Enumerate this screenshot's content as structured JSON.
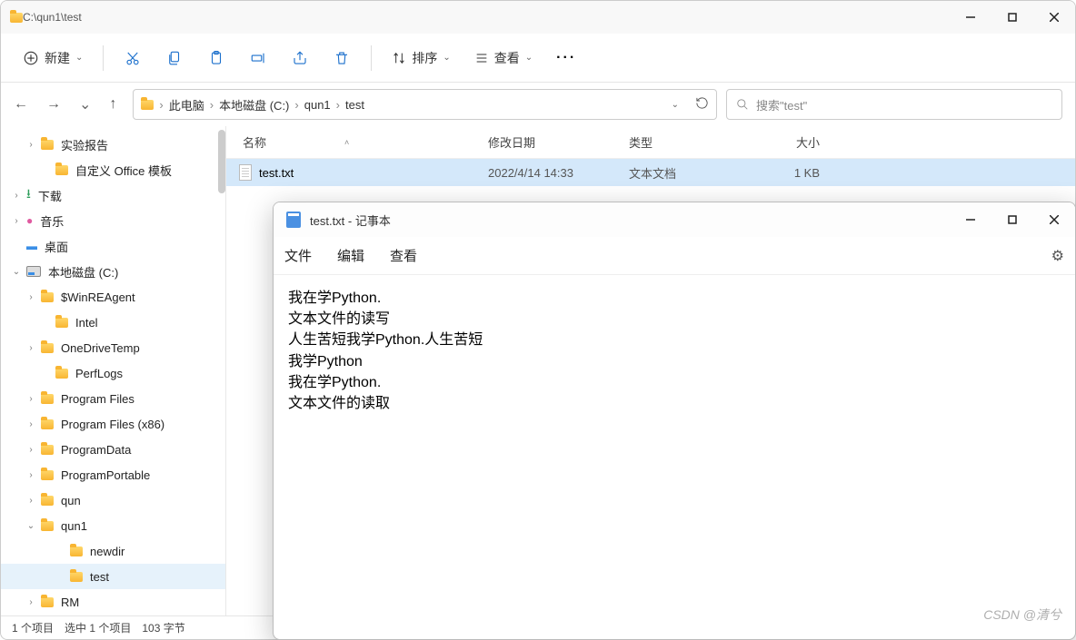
{
  "explorer": {
    "titlePath": "C:\\qun1\\test",
    "toolbar": {
      "new": "新建",
      "sort": "排序",
      "view": "查看"
    },
    "breadcrumb": [
      "此电脑",
      "本地磁盘 (C:)",
      "qun1",
      "test"
    ],
    "searchPlaceholder": "搜索\"test\"",
    "columns": {
      "name": "名称",
      "date": "修改日期",
      "type": "类型",
      "size": "大小"
    },
    "file": {
      "name": "test.txt",
      "date": "2022/4/14 14:33",
      "type": "文本文档",
      "size": "1 KB"
    },
    "tree": [
      {
        "label": "实验报告",
        "indent": 1,
        "arrow": ">",
        "folder": true
      },
      {
        "label": "自定义 Office 模板",
        "indent": 2,
        "arrow": "",
        "folder": true
      },
      {
        "label": "下载",
        "indent": 0,
        "arrow": ">",
        "icon": "download"
      },
      {
        "label": "音乐",
        "indent": 0,
        "arrow": ">",
        "icon": "music"
      },
      {
        "label": "桌面",
        "indent": 0,
        "arrow": "",
        "icon": "desktop"
      },
      {
        "label": "本地磁盘 (C:)",
        "indent": 0,
        "arrow": "v",
        "icon": "disk"
      },
      {
        "label": "$WinREAgent",
        "indent": 1,
        "arrow": ">",
        "folder": true
      },
      {
        "label": "Intel",
        "indent": 2,
        "arrow": "",
        "folder": true
      },
      {
        "label": "OneDriveTemp",
        "indent": 1,
        "arrow": ">",
        "folder": true
      },
      {
        "label": "PerfLogs",
        "indent": 2,
        "arrow": "",
        "folder": true
      },
      {
        "label": "Program Files",
        "indent": 1,
        "arrow": ">",
        "folder": true
      },
      {
        "label": "Program Files (x86)",
        "indent": 1,
        "arrow": ">",
        "folder": true
      },
      {
        "label": "ProgramData",
        "indent": 1,
        "arrow": ">",
        "folder": true
      },
      {
        "label": "ProgramPortable",
        "indent": 1,
        "arrow": ">",
        "folder": true
      },
      {
        "label": "qun",
        "indent": 1,
        "arrow": ">",
        "folder": true
      },
      {
        "label": "qun1",
        "indent": 1,
        "arrow": "v",
        "folder": true
      },
      {
        "label": "newdir",
        "indent": 3,
        "arrow": "",
        "folder": true
      },
      {
        "label": "test",
        "indent": 3,
        "arrow": "",
        "folder": true,
        "selected": true
      },
      {
        "label": "RM",
        "indent": 1,
        "arrow": ">",
        "folder": true
      }
    ],
    "status": {
      "items": "1 个项目",
      "selected": "选中 1 个项目",
      "bytes": "103 字节"
    }
  },
  "notepad": {
    "title": "test.txt - 记事本",
    "menus": {
      "file": "文件",
      "edit": "编辑",
      "view": "查看"
    },
    "content": "我在学Python.\n文本文件的读写\n人生苦短我学Python.人生苦短\n我学Python\n我在学Python.\n文本文件的读取"
  },
  "watermark": "CSDN @清兮"
}
